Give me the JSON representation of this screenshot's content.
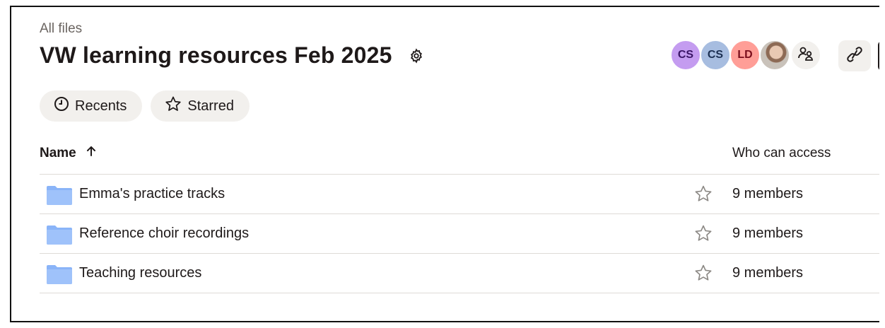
{
  "breadcrumb": "All files",
  "page_title": "VW learning resources Feb 2025",
  "icons": {
    "settings": "gear-icon",
    "share": "share-people-icon",
    "link": "link-icon",
    "recents": "clock-icon",
    "starred": "star-icon",
    "sort": "arrow-up-icon",
    "folder": "folder-icon"
  },
  "members": [
    {
      "initials": "CS",
      "bg": "#c49cf0",
      "fg": "#3a1466"
    },
    {
      "initials": "CS",
      "bg": "#a7bde0",
      "fg": "#1b2f52"
    },
    {
      "initials": "LD",
      "bg": "#ff9e97",
      "fg": "#7a0e1c"
    }
  ],
  "filters": {
    "recents_label": "Recents",
    "starred_label": "Starred"
  },
  "table": {
    "name_header": "Name",
    "access_header": "Who can access",
    "rows": [
      {
        "name": "Emma's practice tracks",
        "access": "9 members"
      },
      {
        "name": "Reference choir recordings",
        "access": "9 members"
      },
      {
        "name": "Teaching resources",
        "access": "9 members"
      }
    ]
  },
  "colors": {
    "folder": "#8ab4f8",
    "chip_bg": "#f2f0ed",
    "text": "#1e1919"
  }
}
